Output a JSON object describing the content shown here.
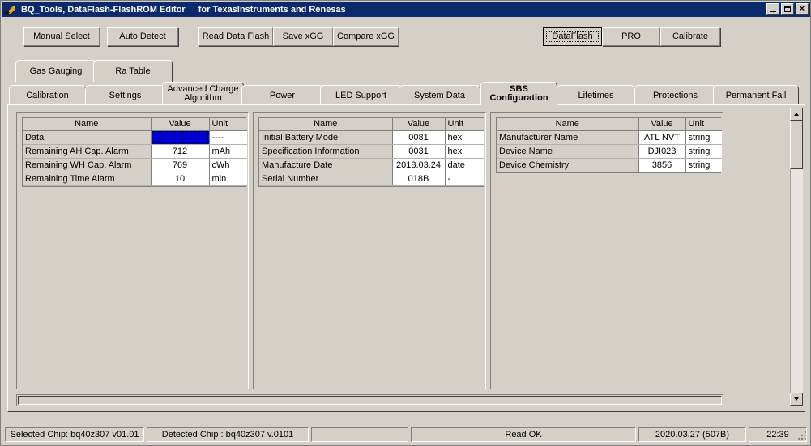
{
  "window": {
    "icon": "pen-icon",
    "title": "BQ_Tools,  DataFlash-FlashROM Editor",
    "subtitle": "for TexasInstruments and Renesas",
    "minimize_label": "_",
    "maximize_label": "",
    "close_label": "×"
  },
  "toolbar": {
    "manual_select": "Manual Select",
    "auto_detect": "Auto Detect",
    "read_data_flash": "Read Data Flash",
    "save_xgg": "Save xGG",
    "compare_xgg": "Compare xGG",
    "dataflash": "DataFlash",
    "pro": "PRO",
    "calibrate": "Calibrate"
  },
  "tabs_row1": [
    {
      "label": "Gas Gauging",
      "selected": false
    },
    {
      "label": "Ra Table",
      "selected": false
    }
  ],
  "tabs_row2": [
    {
      "label": "Calibration",
      "selected": false
    },
    {
      "label": "Settings",
      "selected": false
    },
    {
      "label": "Advanced Charge\nAlgorithm",
      "line1": "Advanced Charge",
      "line2": "Algorithm",
      "selected": false
    },
    {
      "label": "Power",
      "selected": false
    },
    {
      "label": "LED Support",
      "selected": false
    },
    {
      "label": "System Data",
      "selected": false
    },
    {
      "label": "SBS\nConfiguration",
      "line1": "SBS",
      "line2": "Configuration",
      "selected": true
    },
    {
      "label": "Lifetimes",
      "selected": false
    },
    {
      "label": "Protections",
      "selected": false
    },
    {
      "label": "Permanent Fail",
      "selected": false
    }
  ],
  "grids": [
    {
      "headers": {
        "name": "Name",
        "value": "Value",
        "unit": "Unit"
      },
      "rows": [
        {
          "name": "Data",
          "value": "----",
          "unit": "----",
          "selected": true
        },
        {
          "name": "Remaining AH Cap. Alarm",
          "value": "712",
          "unit": "mAh",
          "selected": false
        },
        {
          "name": "Remaining WH Cap. Alarm",
          "value": "769",
          "unit": "cWh",
          "selected": false
        },
        {
          "name": "Remaining Time Alarm",
          "value": "10",
          "unit": "min",
          "selected": false
        }
      ]
    },
    {
      "headers": {
        "name": "Name",
        "value": "Value",
        "unit": "Unit"
      },
      "rows": [
        {
          "name": "Initial Battery Mode",
          "value": "0081",
          "unit": "hex",
          "selected": false
        },
        {
          "name": "Specification Information",
          "value": "0031",
          "unit": "hex",
          "selected": false
        },
        {
          "name": "Manufacture Date",
          "value": "2018.03.24",
          "unit": "date",
          "selected": false
        },
        {
          "name": "Serial Number",
          "value": "018B",
          "unit": "-",
          "selected": false
        }
      ]
    },
    {
      "headers": {
        "name": "Name",
        "value": "Value",
        "unit": "Unit"
      },
      "rows": [
        {
          "name": "Manufacturer Name",
          "value": "ATL NVT",
          "unit": "string",
          "selected": false
        },
        {
          "name": "Device Name",
          "value": "DJI023",
          "unit": "string",
          "selected": false
        },
        {
          "name": "Device Chemistry",
          "value": "3856",
          "unit": "string",
          "selected": false
        }
      ]
    }
  ],
  "statusbar": {
    "selected_chip": "Selected Chip:  bq40z307 v01.01",
    "detected_chip": "Detected Chip : bq40z307  v.0101",
    "blank": "",
    "status": "Read OK",
    "date": "2020.03.27  (507B)",
    "time": "22:39"
  },
  "colors": {
    "titlebar": "#0a2a6b",
    "face": "#d4d0c8",
    "selection": "#0000cd"
  }
}
